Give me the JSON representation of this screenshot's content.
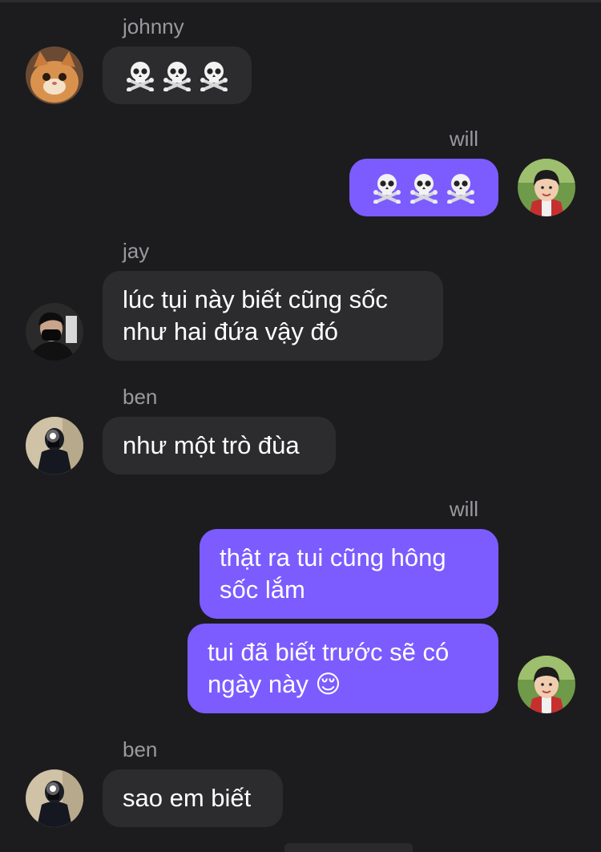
{
  "messages": [
    {
      "sender": "johnny",
      "direction": "incoming",
      "emoji": [
        "skull-crossbones",
        "skull-crossbones",
        "skull-crossbones"
      ]
    },
    {
      "sender": "will",
      "direction": "outgoing",
      "emoji": [
        "skull-crossbones",
        "skull-crossbones",
        "skull-crossbones"
      ]
    },
    {
      "sender": "jay",
      "direction": "incoming",
      "lines": [
        "lúc tụi này biết cũng sốc",
        "như hai đứa vậy đó"
      ]
    },
    {
      "sender": "ben",
      "direction": "incoming",
      "lines": [
        "như một trò đùa"
      ]
    },
    {
      "sender": "will",
      "direction": "outgoing",
      "lines": [
        "thật ra tui cũng hông",
        "sốc lắm"
      ]
    },
    {
      "direction": "outgoing",
      "lines": [
        "tui đã biết trước sẽ có",
        "ngày này 😌"
      ]
    },
    {
      "sender": "ben",
      "direction": "incoming",
      "lines": [
        "sao em biết"
      ]
    }
  ],
  "avatars": {
    "johnny": "cat-photo",
    "will": "child-photo",
    "jay": "masked-person-photo",
    "ben": "mirror-selfie-photo"
  },
  "colors": {
    "background": "#1c1c1e",
    "incoming_bubble": "#2c2c2e",
    "outgoing_bubble": "#7c5cff",
    "sender_label": "#9a9a9e",
    "message_text": "#ffffff"
  }
}
